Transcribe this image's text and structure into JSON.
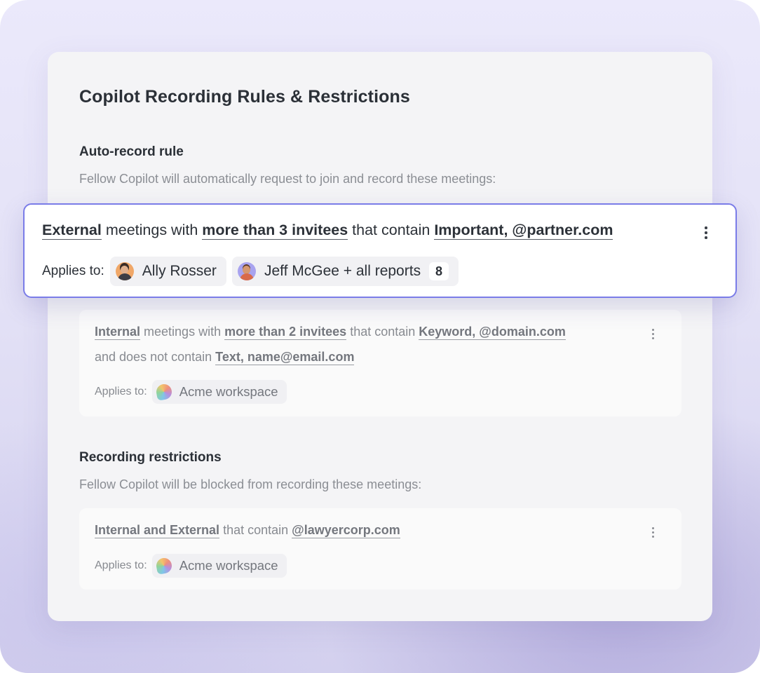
{
  "page": {
    "title": "Copilot Recording Rules & Restrictions"
  },
  "auto_record": {
    "heading": "Auto-record rule",
    "description": "Fellow Copilot will automatically request to join and record these meetings:",
    "rules": [
      {
        "scope": "External",
        "t1": "meetings with",
        "invitees": "more than 3 invitees",
        "t2": "that contain",
        "keywords": "Important, @partner.com",
        "applies_label": "Applies to:",
        "assignees": [
          {
            "name": "Ally Rosser",
            "avatar": "avatar-icon"
          },
          {
            "name": "Jeff McGee + all reports",
            "avatar": "avatar-icon",
            "count": "8"
          }
        ]
      },
      {
        "scope": "Internal",
        "t1": "meetings with",
        "invitees": "more than 2 invitees",
        "t2": "that contain",
        "keywords": "Keyword, @domain.com",
        "t3": "and does not contain",
        "excluded": "Text, name@email.com",
        "applies_label": "Applies to:",
        "assignees": [
          {
            "name": "Acme workspace",
            "avatar": "workspace-logo-icon"
          }
        ]
      }
    ]
  },
  "restrictions": {
    "heading": "Recording restrictions",
    "description": "Fellow Copilot will be blocked from recording these meetings:",
    "rules": [
      {
        "scope": "Internal and External",
        "t1": "that contain",
        "keywords": "@lawyercorp.com",
        "applies_label": "Applies to:",
        "assignees": [
          {
            "name": "Acme workspace",
            "avatar": "workspace-logo-icon"
          }
        ]
      }
    ]
  },
  "colors": {
    "highlight_border": "#7a7ce8",
    "panel_background": "#f4f4f6",
    "page_background": "#e3e1f6"
  }
}
